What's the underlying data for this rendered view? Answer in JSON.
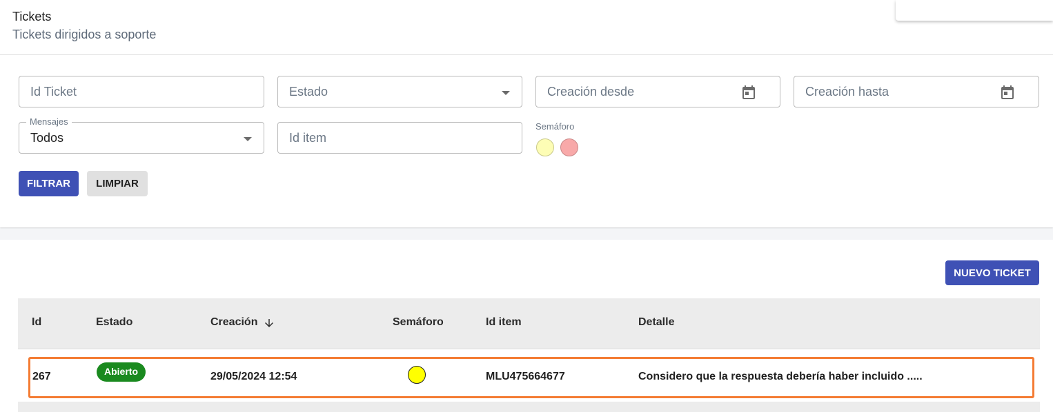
{
  "header": {
    "title": "Tickets",
    "subtitle": "Tickets dirigidos a soporte"
  },
  "filters": {
    "id_ticket_placeholder": "Id Ticket",
    "estado_placeholder": "Estado",
    "creacion_desde_placeholder": "Creación desde",
    "creacion_hasta_placeholder": "Creación hasta",
    "mensajes_label": "Mensajes",
    "mensajes_value": "Todos",
    "id_item_placeholder": "Id item",
    "semaforo_label": "Semáforo",
    "semaforo_options": [
      {
        "name": "yellow",
        "color": "#fdfdb5",
        "border": "#c9c98a"
      },
      {
        "name": "red",
        "color": "#f8a9a9",
        "border": "#c98888"
      }
    ],
    "filtrar_label": "FILTRAR",
    "limpiar_label": "LIMPIAR"
  },
  "list": {
    "new_ticket_label": "NUEVO TICKET",
    "columns": {
      "id": "Id",
      "estado": "Estado",
      "creacion": "Creación",
      "semaforo": "Semáforo",
      "id_item": "Id item",
      "detalle": "Detalle"
    },
    "sort": {
      "column": "creacion",
      "direction": "desc"
    },
    "rows": [
      {
        "id": "267",
        "estado": "Abierto",
        "estado_color": "#1a8a1f",
        "creacion": "29/05/2024 12:54",
        "semaforo_color": "#ffff00",
        "id_item": "MLU475664677",
        "detalle": "Considero que la respuesta debería haber incluido ....."
      }
    ]
  },
  "colors": {
    "primary": "#3f51b5",
    "highlight": "#f47c34"
  }
}
